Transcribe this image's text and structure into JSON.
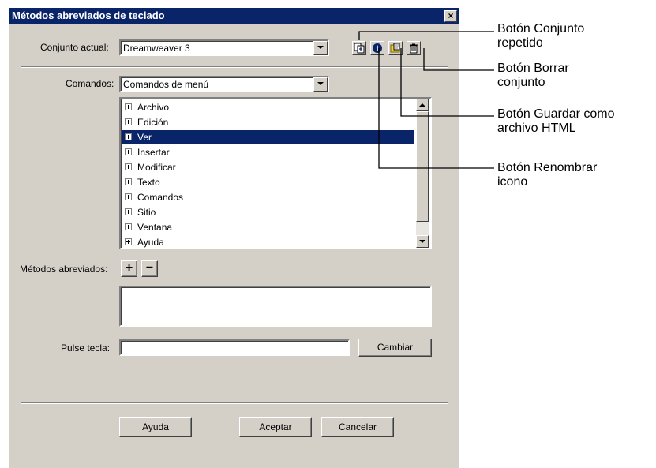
{
  "dialog": {
    "title": "Métodos abreviados de teclado",
    "close_label": "×"
  },
  "conjunto": {
    "label": "Conjunto actual:",
    "value": "Dreamweaver 3"
  },
  "toolbar": {
    "icons": [
      "duplicate-set-icon",
      "rename-icon",
      "save-as-html-icon",
      "delete-set-icon"
    ]
  },
  "comandos": {
    "label": "Comandos:",
    "value": "Comandos de menú"
  },
  "tree": {
    "items": [
      "Archivo",
      "Edición",
      "Ver",
      "Insertar",
      "Modificar",
      "Texto",
      "Comandos",
      "Sitio",
      "Ventana",
      "Ayuda"
    ],
    "selected_index": 2
  },
  "shortcuts": {
    "label": "Métodos abreviados:",
    "add_label": "+",
    "remove_label": "−"
  },
  "presskey": {
    "label": "Pulse tecla:",
    "value": "",
    "change_label": "Cambiar"
  },
  "footer": {
    "help_label": "Ayuda",
    "ok_label": "Aceptar",
    "cancel_label": "Cancelar"
  },
  "callouts": [
    {
      "line1": "Botón Conjunto",
      "line2": "repetido"
    },
    {
      "line1": "Botón Borrar",
      "line2": "conjunto"
    },
    {
      "line1": "Botón Guardar como",
      "line2": "archivo HTML"
    },
    {
      "line1": "Botón Renombrar",
      "line2": "icono"
    }
  ]
}
